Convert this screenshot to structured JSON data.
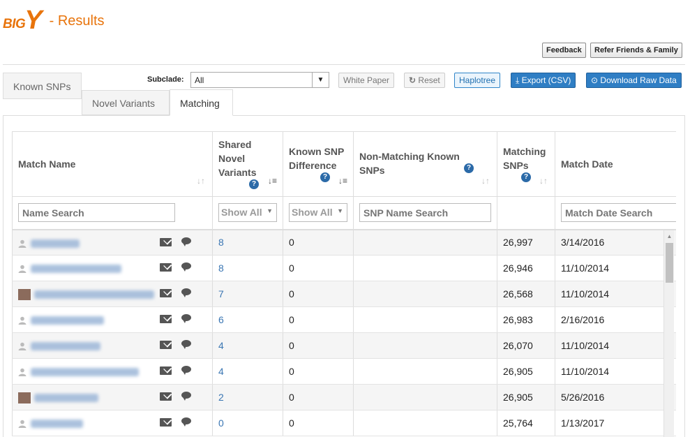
{
  "header": {
    "logo_big": "BIG",
    "logo_y": "Y",
    "title": "- Results",
    "buttons": {
      "feedback": "Feedback",
      "refer": "Refer Friends & Family"
    }
  },
  "tabs": {
    "known_snps": "Known SNPs",
    "novel_variants": "Novel Variants",
    "matching": "Matching"
  },
  "toolbar": {
    "subclade_label": "Subclade:",
    "subclade_value": "All",
    "white_paper": "White Paper",
    "reset": "Reset",
    "haplotree": "Haplotree",
    "export": "Export (CSV)",
    "download": "Download Raw Data"
  },
  "table": {
    "columns": {
      "match_name": "Match Name",
      "shared_novel_line1": "Shared",
      "shared_novel_line2": "Novel",
      "shared_novel_line3": "Variants",
      "known_diff_line1": "Known SNP",
      "known_diff_line2": "Difference",
      "nonmatch_line1": "Non-Matching Known",
      "nonmatch_line2": "SNPs",
      "matching_line1": "Matching",
      "matching_line2": "SNPs",
      "match_date": "Match Date"
    },
    "filters": {
      "name_placeholder": "Name Search",
      "shared_select": "Show All",
      "diff_select": "Show All",
      "snp_placeholder": "SNP Name Search",
      "date_placeholder": "Match Date Search"
    },
    "rows": [
      {
        "shared": "8",
        "diff": "0",
        "matching": "26,997",
        "date": "3/14/2016"
      },
      {
        "shared": "8",
        "diff": "0",
        "matching": "26,946",
        "date": "11/10/2014"
      },
      {
        "shared": "7",
        "diff": "0",
        "matching": "26,568",
        "date": "11/10/2014"
      },
      {
        "shared": "6",
        "diff": "0",
        "matching": "26,983",
        "date": "2/16/2016"
      },
      {
        "shared": "4",
        "diff": "0",
        "matching": "26,070",
        "date": "11/10/2014"
      },
      {
        "shared": "4",
        "diff": "0",
        "matching": "26,905",
        "date": "11/10/2014"
      },
      {
        "shared": "2",
        "diff": "0",
        "matching": "26,905",
        "date": "5/26/2016"
      },
      {
        "shared": "0",
        "diff": "0",
        "matching": "25,764",
        "date": "1/13/2017"
      }
    ]
  },
  "colors": {
    "brand_orange": "#e8740c",
    "link_blue": "#3a76b3",
    "button_blue": "#2f7ec4"
  }
}
